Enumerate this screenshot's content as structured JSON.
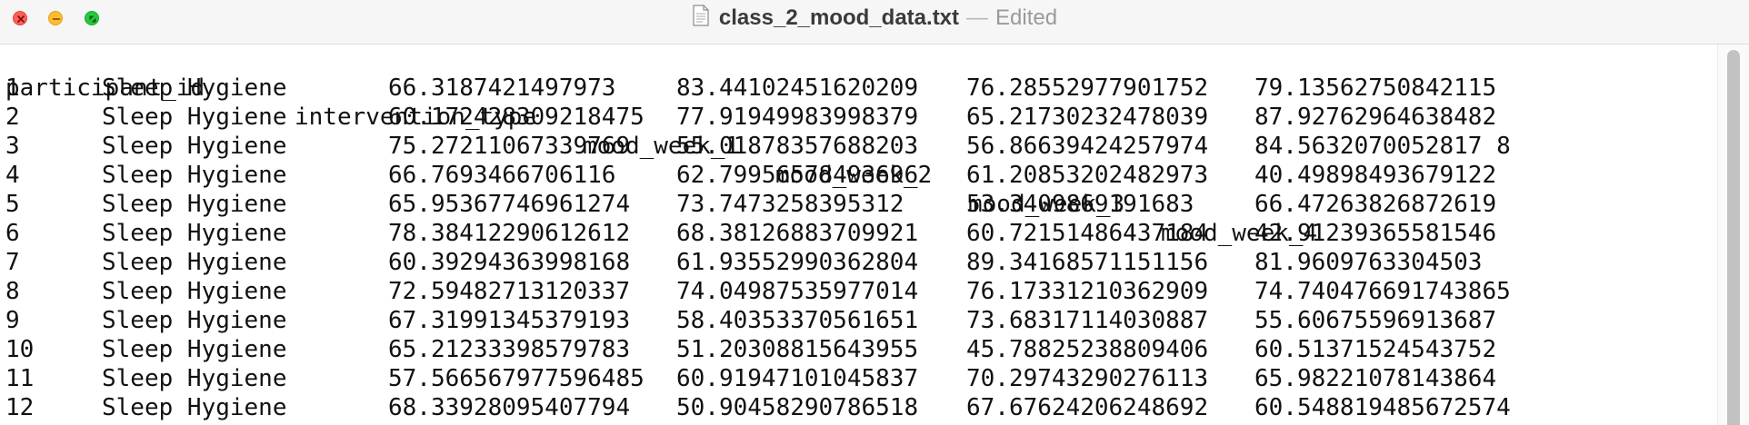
{
  "window": {
    "filename": "class_2_mood_data.txt",
    "separator": "—",
    "status": "Edited",
    "icons": {
      "close": "close-icon",
      "minimize": "minimize-icon",
      "maximize": "fullscreen-icon",
      "document": "text-document-icon"
    },
    "colors": {
      "close": "#ff5f57",
      "minimize": "#febc2e",
      "maximize": "#28c840"
    }
  },
  "table": {
    "headers": [
      "participant_id",
      "intervention_type",
      "mood_week_1",
      "mood_week_2",
      "mood_week_3",
      "mood_week_4"
    ],
    "rows": [
      [
        "1",
        "Sleep Hygiene",
        "66.3187421497973",
        "83.44102451620209",
        "76.28552977901752",
        "79.13562750842115"
      ],
      [
        "2",
        "Sleep Hygiene",
        "60.172428309218475",
        "77.91949983998379",
        "65.21730232478039",
        "87.92762964638482"
      ],
      [
        "3",
        "Sleep Hygiene",
        "75.27211067339769",
        "55.01878357688203",
        "56.86639424257974",
        "84.5632070052817 8"
      ],
      [
        "4",
        "Sleep Hygiene",
        "66.7693466706116",
        "62.79956578493696",
        "61.20853202482973",
        "40.49898493679122"
      ],
      [
        "5",
        "Sleep Hygiene",
        "65.95367746961274",
        "73.7473258395312",
        "53.3409869191683",
        "66.47263826872619"
      ],
      [
        "6",
        "Sleep Hygiene",
        "78.38412290612612",
        "68.38126883709921",
        "60.72151486437184",
        "42.91239365581546"
      ],
      [
        "7",
        "Sleep Hygiene",
        "60.39294363998168",
        "61.93552990362804",
        "89.34168571151156",
        "81.9609763304503"
      ],
      [
        "8",
        "Sleep Hygiene",
        "72.59482713120337",
        "74.04987535977014",
        "76.17331210362909",
        "74.740476691743865"
      ],
      [
        "9",
        "Sleep Hygiene",
        "67.31991345379193",
        "58.40353370561651",
        "73.68317114030887",
        "55.60675596913687"
      ],
      [
        "10",
        "Sleep Hygiene",
        "65.21233398579783",
        "51.20308815643955",
        "45.78825238809406",
        "60.51371524543752"
      ],
      [
        "11",
        "Sleep Hygiene",
        "57.566567977596485",
        "60.91947101045837",
        "70.29743290276113",
        "65.98221078143864"
      ],
      [
        "12",
        "Sleep Hygiene",
        "68.33928095407794",
        "50.90458290786518",
        "67.67624206248692",
        "60.548819485672574"
      ]
    ]
  }
}
